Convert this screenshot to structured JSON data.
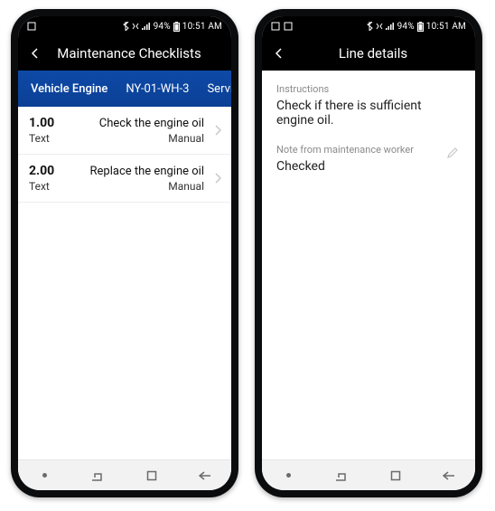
{
  "statusbar": {
    "battery_pct": "94%",
    "time": "10:51 AM"
  },
  "screen1": {
    "header_title": "Maintenance Checklists",
    "tabs": {
      "t0": "Vehicle Engine",
      "t1": "NY-01-WH-3",
      "t2": "Service"
    },
    "rows": [
      {
        "num": "1.00",
        "type": "Text",
        "title": "Check the engine oil",
        "mode": "Manual"
      },
      {
        "num": "2.00",
        "type": "Text",
        "title": "Replace the engine oil",
        "mode": "Manual"
      }
    ]
  },
  "screen2": {
    "header_title": "Line details",
    "instructions_label": "Instructions",
    "instructions_value": "Check if there is sufficient engine oil.",
    "note_label": "Note from maintenance worker",
    "note_value": "Checked"
  }
}
